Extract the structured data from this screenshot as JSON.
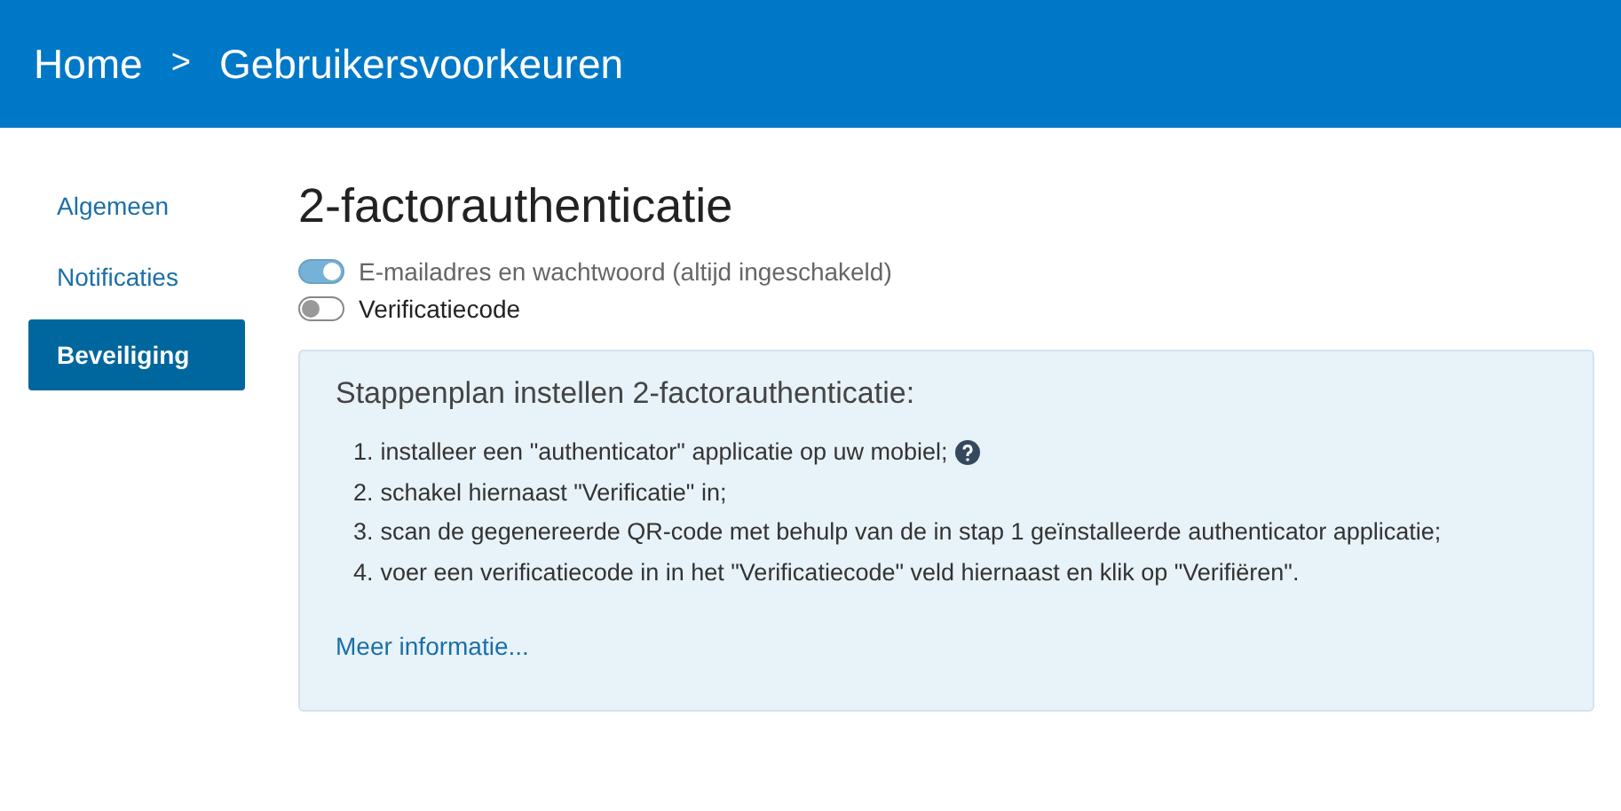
{
  "header": {
    "breadcrumb": [
      {
        "label": "Home"
      },
      {
        "label": ">",
        "kind": "separator"
      },
      {
        "label": "Gebruikersvoorkeuren"
      }
    ]
  },
  "sidebar": {
    "items": [
      {
        "label": "Algemeen",
        "selected": false
      },
      {
        "label": "Notificaties",
        "selected": false
      },
      {
        "label": "Beveiliging",
        "selected": true
      }
    ]
  },
  "title": "2-factorauthenticatie",
  "toggles": [
    {
      "label": "E-mailadres en wachtwoord (altijd ingeschakeld)",
      "on": true,
      "disabled": true
    },
    {
      "label": "Verificatiecode",
      "on": false,
      "disabled": false
    }
  ],
  "panel": {
    "heading": "Stappenplan instellen 2-factorauthenticatie:",
    "steps": [
      {
        "number": "1.",
        "text": "installeer een \"authenticator\" applicatie op uw mobiel;",
        "help": true
      },
      {
        "number": "2.",
        "text": "schakel hiernaast \"Verificatie\" in;",
        "help": false
      },
      {
        "number": "3.",
        "text": "scan de gegenereerde QR-code met behulp van de in stap 1 geïnstalleerde authenticator applicatie;",
        "help": false
      },
      {
        "number": "4.",
        "text": "voer een verificatiecode in in het \"Verificatiecode\" veld hiernaast en klik op \"Verifiëren\".",
        "help": false
      }
    ],
    "link": "Meer informatie..."
  }
}
